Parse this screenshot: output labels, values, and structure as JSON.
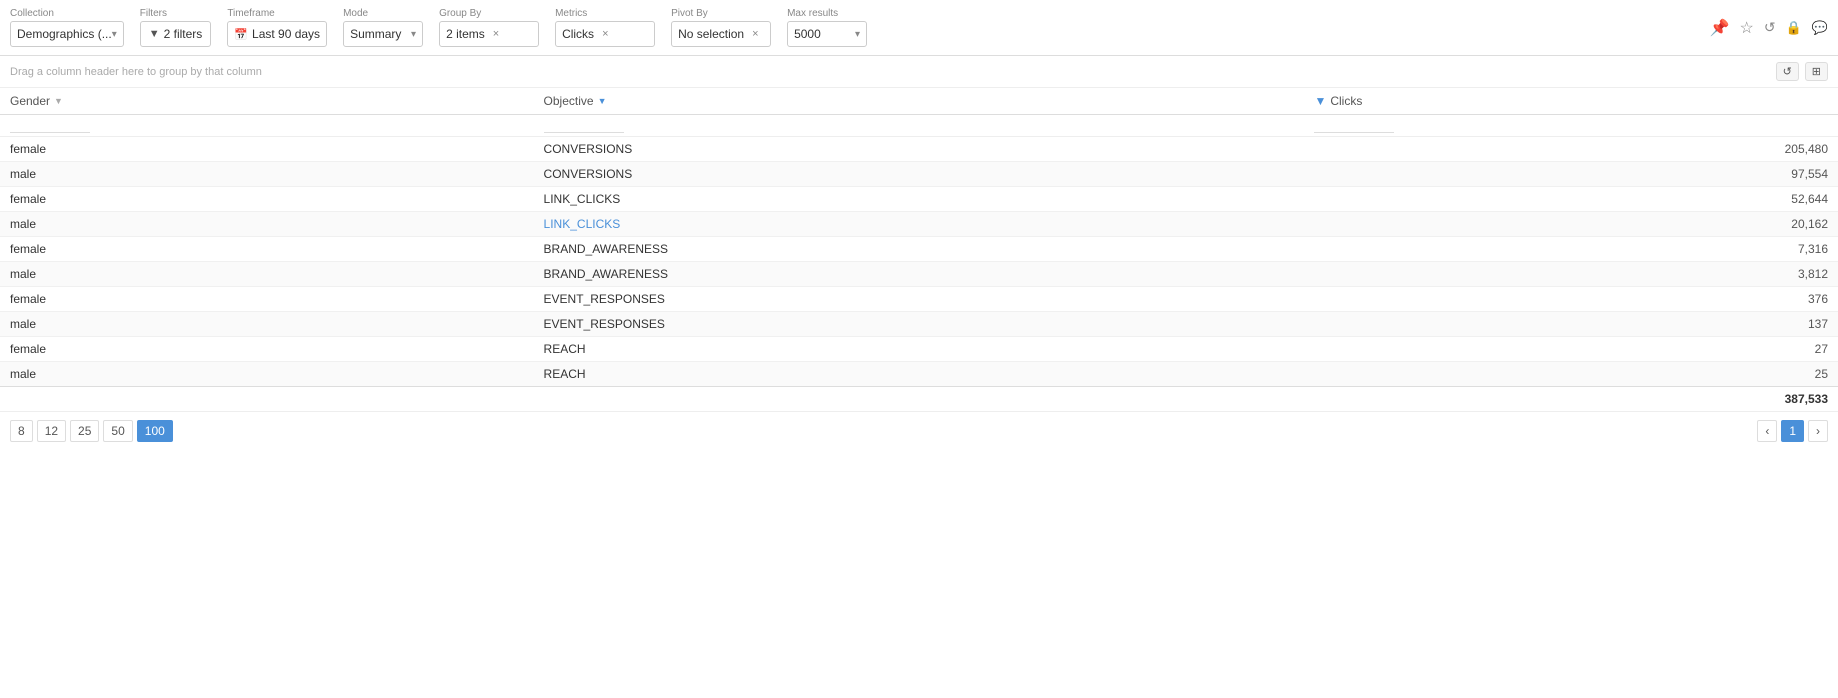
{
  "toolbar": {
    "collection_label": "Collection",
    "collection_value": "Demographics (...",
    "filters_label": "Filters",
    "filters_value": "2 filters",
    "timeframe_label": "Timeframe",
    "timeframe_value": "Last 90 days",
    "mode_label": "Mode",
    "mode_value": "Summary",
    "groupby_label": "Group By",
    "groupby_value": "2 items",
    "metrics_label": "Metrics",
    "metrics_value": "Clicks",
    "pivotby_label": "Pivot By",
    "pivotby_value": "No selection",
    "maxresults_label": "Max results",
    "maxresults_value": "5000"
  },
  "drag_bar": {
    "text": "Drag a column header here to group by that column"
  },
  "table": {
    "columns": [
      {
        "id": "gender",
        "label": "Gender",
        "filterable": true,
        "filter_icon": false
      },
      {
        "id": "objective",
        "label": "Objective",
        "filterable": true,
        "filter_icon": true
      },
      {
        "id": "clicks",
        "label": "Clicks",
        "filterable": true,
        "filter_icon": true
      }
    ],
    "rows": [
      {
        "gender": "female",
        "objective": "CONVERSIONS",
        "clicks": "205,480",
        "obj_link": false
      },
      {
        "gender": "male",
        "objective": "CONVERSIONS",
        "clicks": "97,554",
        "obj_link": false
      },
      {
        "gender": "female",
        "objective": "LINK_CLICKS",
        "clicks": "52,644",
        "obj_link": false
      },
      {
        "gender": "male",
        "objective": "LINK_CLICKS",
        "clicks": "20,162",
        "obj_link": true
      },
      {
        "gender": "female",
        "objective": "BRAND_AWARENESS",
        "clicks": "7,316",
        "obj_link": false
      },
      {
        "gender": "male",
        "objective": "BRAND_AWARENESS",
        "clicks": "3,812",
        "obj_link": false
      },
      {
        "gender": "female",
        "objective": "EVENT_RESPONSES",
        "clicks": "376",
        "obj_link": false
      },
      {
        "gender": "male",
        "objective": "EVENT_RESPONSES",
        "clicks": "137",
        "obj_link": false
      },
      {
        "gender": "female",
        "objective": "REACH",
        "clicks": "27",
        "obj_link": false
      },
      {
        "gender": "male",
        "objective": "REACH",
        "clicks": "25",
        "obj_link": false
      }
    ],
    "total": "387,533"
  },
  "pagination": {
    "page_sizes": [
      "8",
      "12",
      "25",
      "50",
      "100"
    ],
    "active_size": "100",
    "current_page": "1"
  },
  "icons": {
    "pin": "📌",
    "star": "☆",
    "undo": "↺",
    "lock": "🔒",
    "chat": "💬",
    "filter": "▼",
    "search": "🔍",
    "calendar": "📅",
    "close": "×",
    "dropdown": "▾",
    "prev": "‹",
    "next": "›",
    "reset": "↺",
    "expand": "⊞"
  }
}
